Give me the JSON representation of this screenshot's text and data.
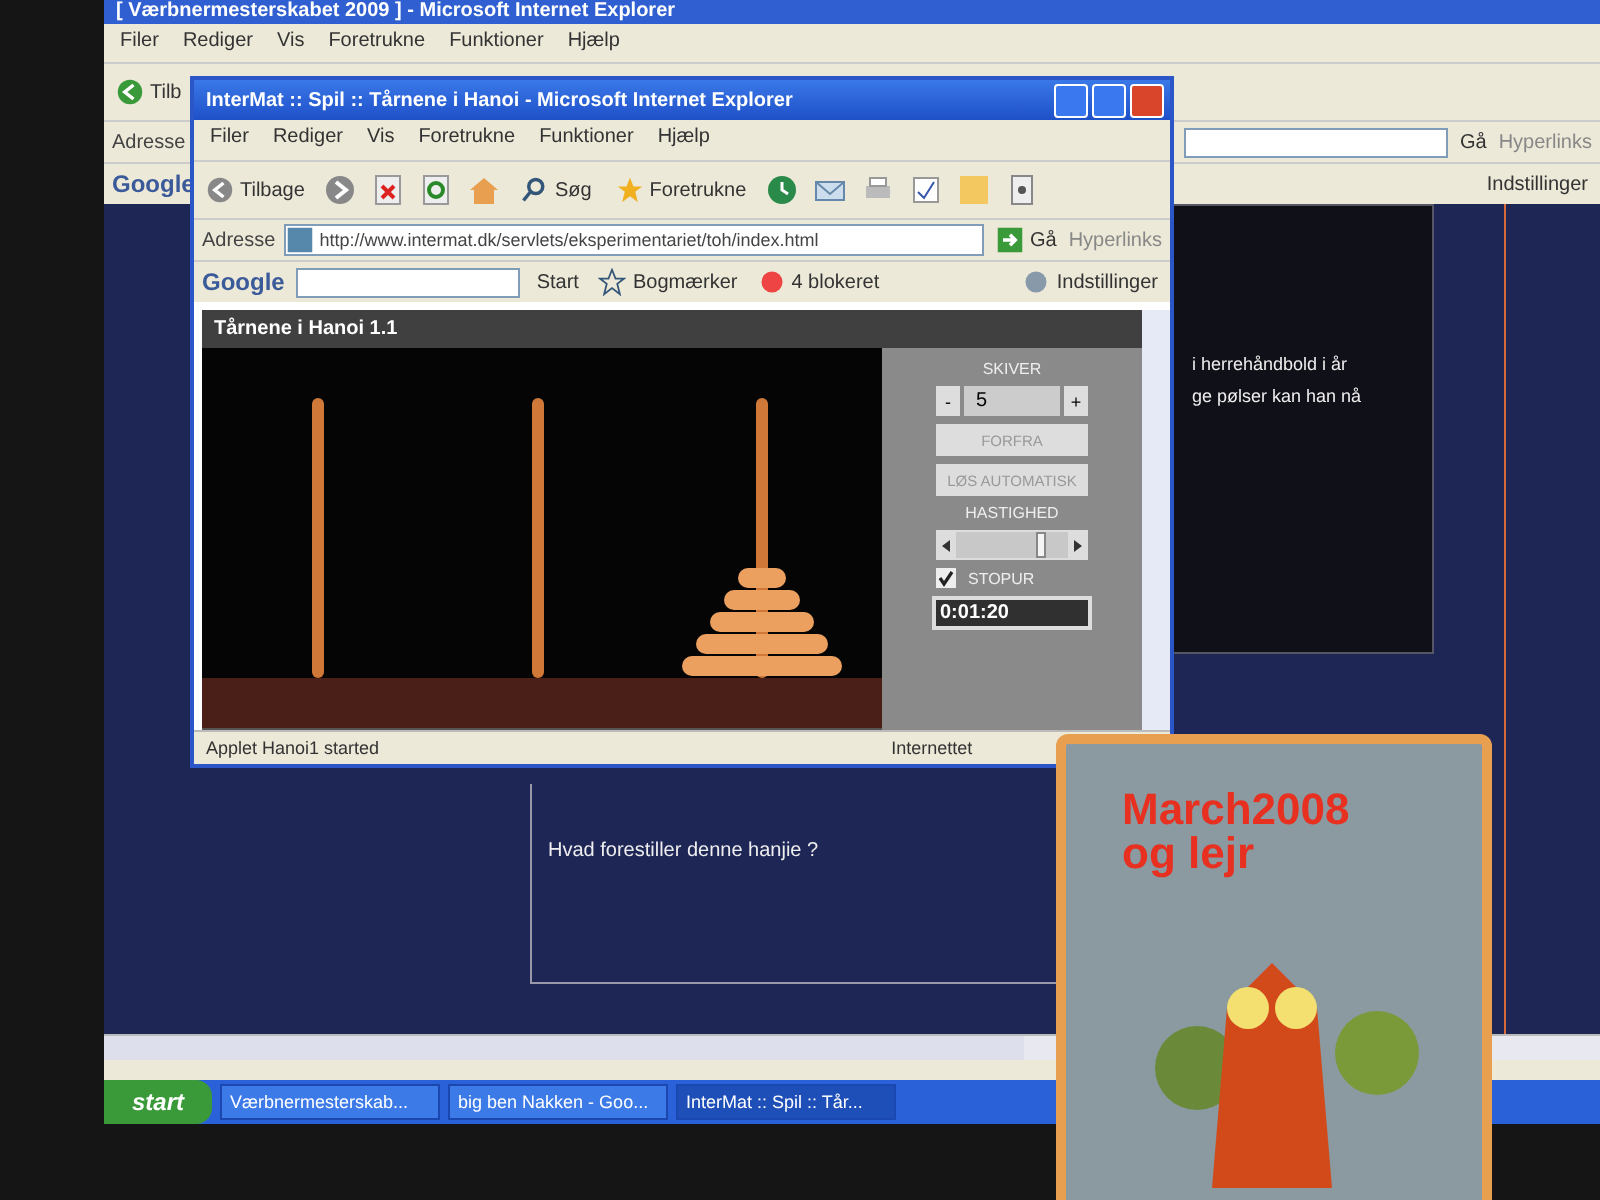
{
  "back_window": {
    "title": "[ Værbnermesterskabet 2009 ] - Microsoft Internet Explorer",
    "menu": [
      "Filer",
      "Rediger",
      "Vis",
      "Foretrukne",
      "Funktioner",
      "Hjælp"
    ],
    "back_label": "Tilb",
    "address_label": "Adresse",
    "google": "Google",
    "go_label": "Gå",
    "links_label": "Hyperlinks",
    "settings_label": "Indstillinger",
    "page_lines": [
      "i herrehåndbold i år",
      "ge pølser kan han nå"
    ],
    "question": "Hvad forestiller denne hanjie ?"
  },
  "front_window": {
    "title": "InterMat :: Spil :: Tårnene i Hanoi - Microsoft Internet Explorer",
    "menu": [
      "Filer",
      "Rediger",
      "Vis",
      "Foretrukne",
      "Funktioner",
      "Hjælp"
    ],
    "toolbar": {
      "back": "Tilbage",
      "search": "Søg",
      "favorites": "Foretrukne"
    },
    "address_label": "Adresse",
    "url": "http://www.intermat.dk/servlets/eksperimentariet/toh/index.html",
    "go_label": "Gå",
    "links_label": "Hyperlinks",
    "google_bar": {
      "logo": "Google",
      "start": "Start",
      "bookmarks": "Bogmærker",
      "blocked": "4 blokeret",
      "settings": "Indstillinger"
    },
    "applet": {
      "title": "Tårnene i Hanoi  1.1",
      "disks_label": "SKIVER",
      "minus": "-",
      "disks_value": "5",
      "plus": "+",
      "restart": "FORFRA",
      "solve": "LØS AUTOMATISK",
      "speed_label": "HASTIGHED",
      "speed": {
        "level": 0.82
      },
      "stopwatch": {
        "label": "STOPUR",
        "checked": true
      },
      "time": "0:01:20"
    },
    "status": {
      "text": "Applet Hanoi1 started",
      "zone": "Internettet"
    }
  },
  "taskbar": {
    "start": "start",
    "tasks": [
      {
        "label": "Værbnermesterskab...",
        "selected": false
      },
      {
        "label": "big ben Nakken - Goo...",
        "selected": false
      },
      {
        "label": "InterMat :: Spil :: Tår...",
        "selected": true
      }
    ]
  },
  "notebook": {
    "title_lines": [
      "March2008",
      "og lejr"
    ]
  }
}
